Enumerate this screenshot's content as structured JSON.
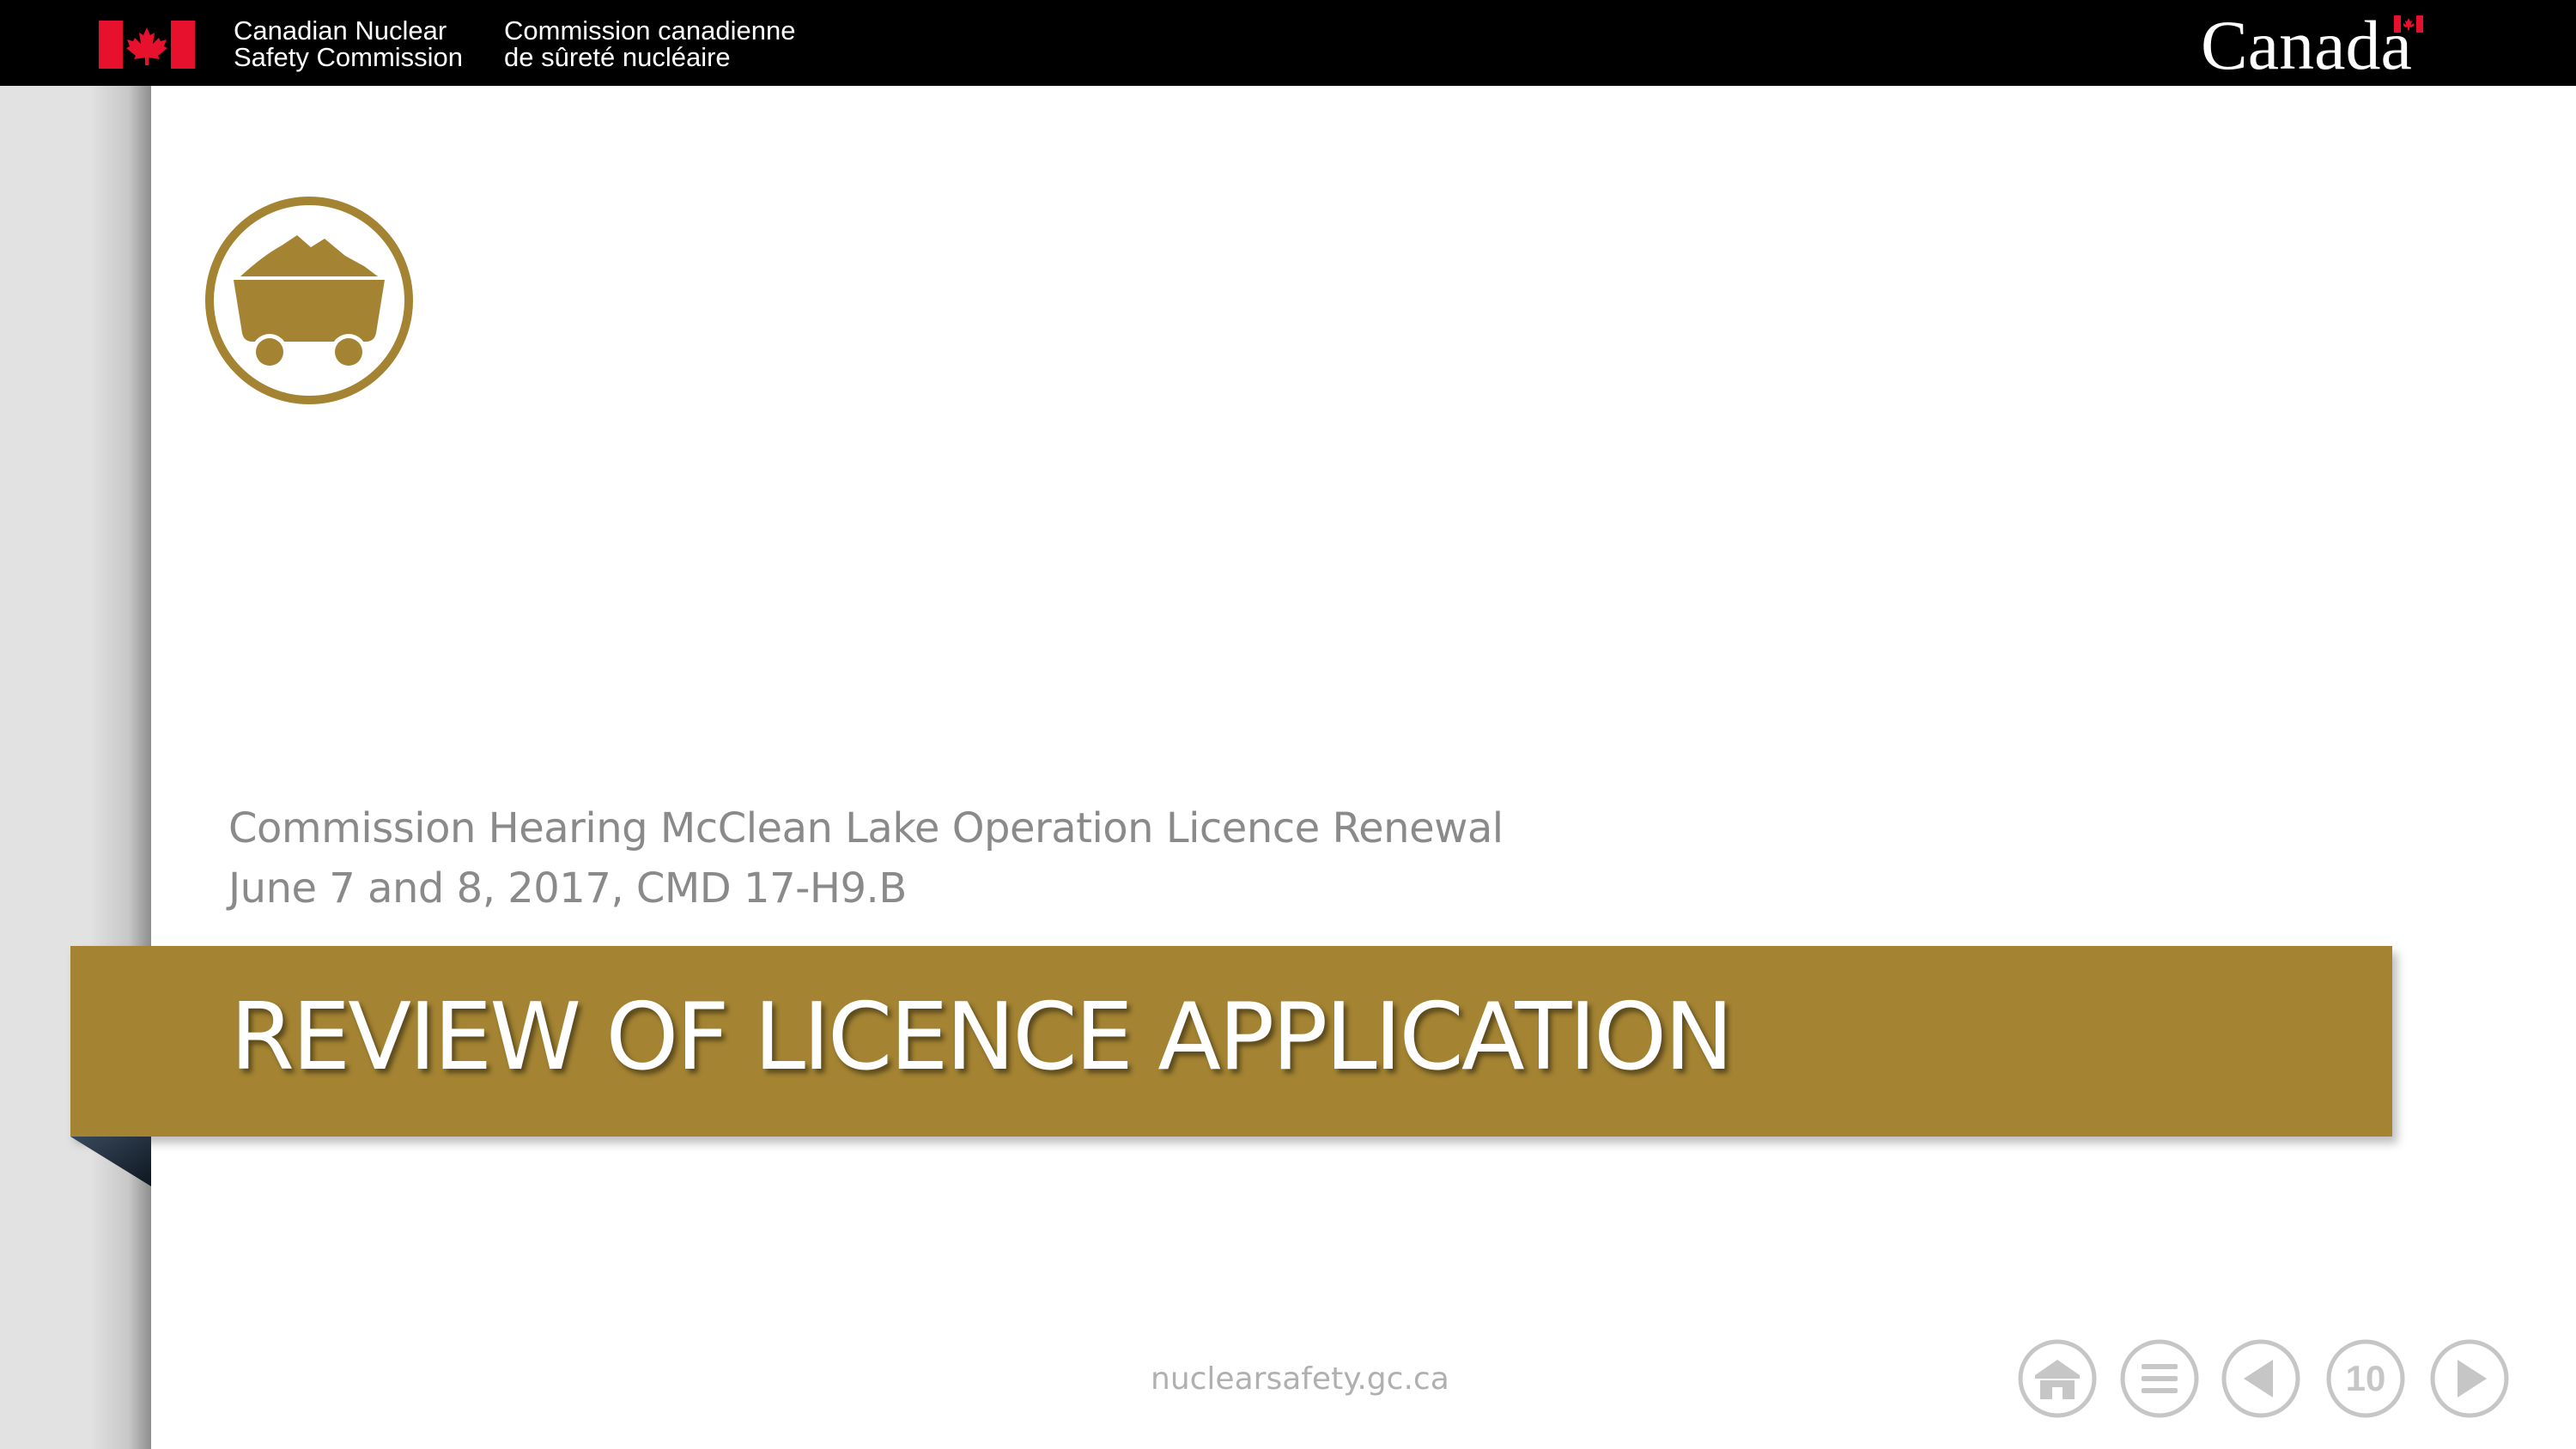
{
  "header": {
    "org_en_line1": "Canadian Nuclear",
    "org_en_line2": "Safety Commission",
    "org_fr_line1": "Commission canadienne",
    "org_fr_line2": "de sûreté nucléaire",
    "wordmark": "Canada",
    "flag_icon": "canada-flag-icon"
  },
  "slide": {
    "badge_icon": "mining-cart-icon",
    "subtitle_line1": "Commission Hearing McClean Lake Operation Licence Renewal",
    "subtitle_line2": "June 7 and 8, 2017, CMD 17-H9.B",
    "title": "REVIEW OF LICENCE APPLICATION"
  },
  "footer": {
    "url": "nuclearsafety.gc.ca",
    "nav": {
      "home_icon": "home-icon",
      "menu_icon": "menu-icon",
      "previous_icon": "previous-icon",
      "page_number": "10",
      "next_icon": "next-icon"
    }
  },
  "colors": {
    "accent_gold": "#a48432",
    "header_black": "#000000",
    "flag_red": "#e8112d",
    "subtitle_gray": "#8a8a8a",
    "nav_gray": "#c6c6c6"
  }
}
